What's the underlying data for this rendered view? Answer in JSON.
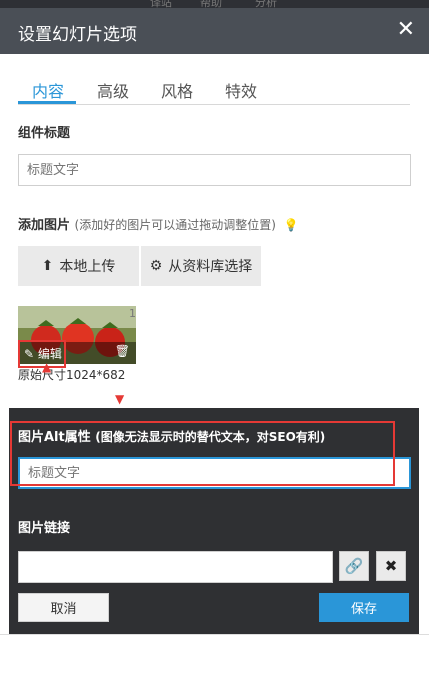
{
  "top_strip": {
    "items": [
      "译站",
      "帮助",
      "分析"
    ]
  },
  "dialog": {
    "title": "设置幻灯片选项",
    "close_glyph": "✕"
  },
  "tabs": [
    "内容",
    "高级",
    "风格",
    "特效"
  ],
  "component_title": {
    "label": "组件标题",
    "placeholder": "标题文字"
  },
  "add_image": {
    "label": "添加图片",
    "hint": "(添加好的图片可以通过拖动调整位置)",
    "upload_label": "本地上传",
    "library_label": "从资料库选择"
  },
  "thumbnail": {
    "edit_label": "编辑",
    "index": "1",
    "original_size": "原始尺寸1024*682"
  },
  "alt_attr": {
    "label": "图片Alt属性",
    "hint": "(图像无法显示时的替代文本，对SEO有利)",
    "placeholder": "标题文字"
  },
  "image_link": {
    "label": "图片链接",
    "value": ""
  },
  "actions": {
    "cancel_label": "取消",
    "save_label": "保存"
  },
  "colors": {
    "accent": "#2a96d8",
    "header_bg": "#4a4f56",
    "panel_bg": "#2f3033",
    "highlight": "#e53935"
  }
}
